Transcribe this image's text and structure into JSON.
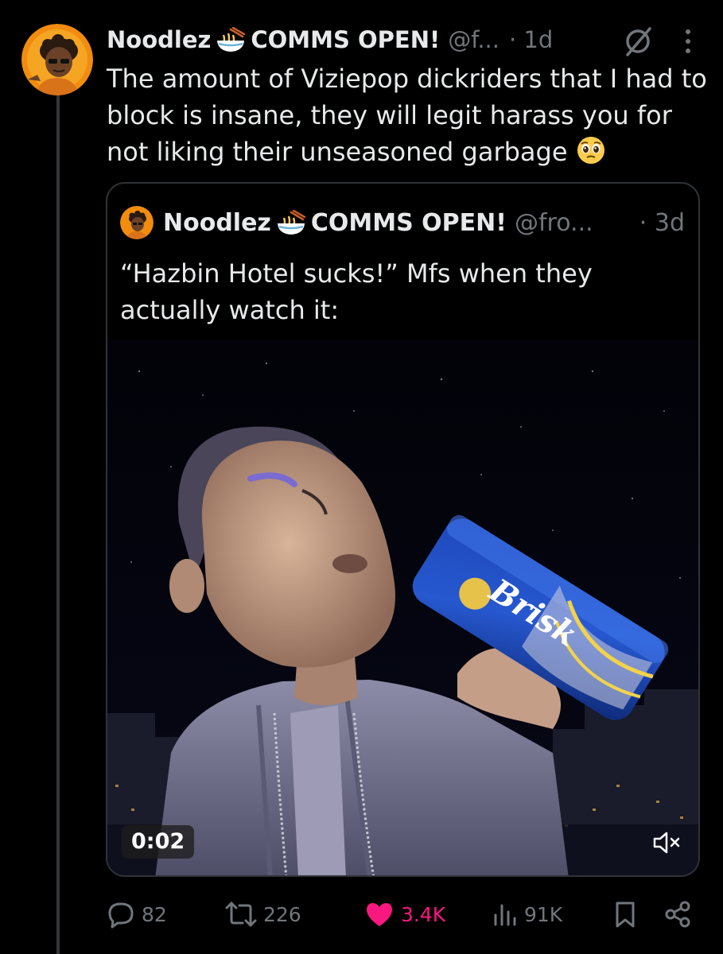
{
  "tweet": {
    "display_name": "Noodlez",
    "name_suffix": "COMMS OPEN!",
    "handle": "@f...",
    "time": "· 1d",
    "text": "The amount of Viziepop dickriders that I had to block is insane, they will legit harass you for not liking their unseasoned garbage",
    "icons": {
      "name_emoji": "noodle-bowl-icon",
      "text_emoji": "pleading-face-icon",
      "grok": "grok-icon",
      "more": "more-icon"
    }
  },
  "quote": {
    "display_name": "Noodlez",
    "name_suffix": "COMMS OPEN!",
    "handle": "@fro...",
    "time": "· 3d",
    "text": "“Hazbin Hotel sucks!” Mfs when they actually watch it:",
    "video": {
      "timer": "0:02",
      "can_text": "Brisk",
      "mute_icon": "mute-icon"
    }
  },
  "actions": {
    "replies": "82",
    "reposts": "226",
    "likes": "3.4K",
    "views": "91K",
    "like_color": "#f91880",
    "muted_color": "#71767b"
  },
  "colors": {
    "background": "#000000",
    "text": "#e7e9ea",
    "secondary": "#71767b",
    "border": "#2f3336",
    "avatar_bg": "#f28c0f"
  }
}
